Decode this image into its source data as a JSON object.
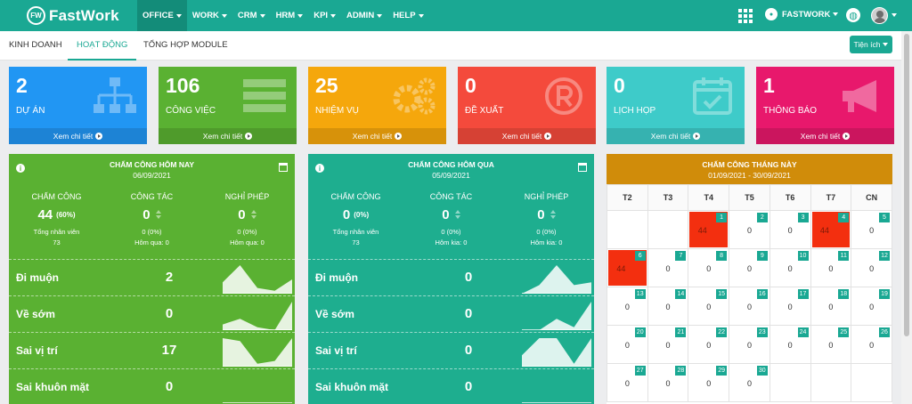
{
  "brand": {
    "logo_mark": "FW",
    "name": "FastWork"
  },
  "menu": [
    {
      "label": "OFFICE"
    },
    {
      "label": "WORK"
    },
    {
      "label": "CRM"
    },
    {
      "label": "HRM"
    },
    {
      "label": "KPI"
    },
    {
      "label": "ADMIN"
    },
    {
      "label": "HELP"
    }
  ],
  "header_right": {
    "company": "FASTWORK",
    "apps_icon": "grid-icon",
    "globe_icon": "globe-icon"
  },
  "subnav": {
    "tabs": [
      "KINH DOANH",
      "HOẠT ĐỘNG",
      "TỔNG HỢP MODULE"
    ],
    "active": "HOẠT ĐỘNG",
    "utility_button": "Tiện ích"
  },
  "stats": [
    {
      "value": "2",
      "label": "DỰ ÁN",
      "link": "Xem chi tiết",
      "color": "#2196f3",
      "icon": "sitemap-icon"
    },
    {
      "value": "106",
      "label": "CÔNG VIỆC",
      "link": "Xem chi tiết",
      "color": "#5ab132",
      "icon": "list-icon"
    },
    {
      "value": "25",
      "label": "NHIỆM VỤ",
      "link": "Xem chi tiết",
      "color": "#f5a70c",
      "icon": "gears-icon"
    },
    {
      "value": "0",
      "label": "ĐỀ XUẤT",
      "link": "Xem chi tiết",
      "color": "#f44a3c",
      "icon": "registered-icon"
    },
    {
      "value": "0",
      "label": "LỊCH HỌP",
      "link": "Xem chi tiết",
      "color": "#3ecbc9",
      "icon": "calendar-check-icon"
    },
    {
      "value": "1",
      "label": "THÔNG BÁO",
      "link": "Xem chi tiết",
      "color": "#e8186c",
      "icon": "megaphone-icon"
    }
  ],
  "today": {
    "title": "CHẤM CÔNG HÔM NAY",
    "date": "06/09/2021",
    "color": "#5ab132",
    "cols": [
      {
        "title": "CHẤM CÔNG",
        "value": "44",
        "extra": "(60%)",
        "sub1": "Tổng nhân viên",
        "sub2": "73"
      },
      {
        "title": "CÔNG TÁC",
        "value": "0",
        "extra": "",
        "sub1": "0 (0%)",
        "sub2": "Hôm qua: 0"
      },
      {
        "title": "NGHỈ PHÉP",
        "value": "0",
        "extra": "",
        "sub1": "0 (0%)",
        "sub2": "Hôm qua: 0"
      }
    ],
    "rows": [
      {
        "label": "Đi muộn",
        "value": "2",
        "spark": [
          4,
          10,
          2,
          1,
          5
        ]
      },
      {
        "label": "Về sớm",
        "value": "0",
        "spark": [
          2,
          4,
          1,
          0,
          10
        ]
      },
      {
        "label": "Sai vị trí",
        "value": "17",
        "spark": [
          10,
          9,
          1,
          2,
          10
        ]
      },
      {
        "label": "Sai khuôn mặt",
        "value": "0",
        "spark": [
          0,
          0,
          0,
          0,
          0
        ]
      }
    ]
  },
  "yesterday": {
    "title": "CHẤM CÔNG HÔM QUA",
    "date": "05/09/2021",
    "color": "#1eae8f",
    "cols": [
      {
        "title": "CHẤM CÔNG",
        "value": "0",
        "extra": "(0%)",
        "sub1": "Tổng nhân viên",
        "sub2": "73"
      },
      {
        "title": "CÔNG TÁC",
        "value": "0",
        "extra": "",
        "sub1": "0 (0%)",
        "sub2": "Hôm kia: 0"
      },
      {
        "title": "NGHỈ PHÉP",
        "value": "0",
        "extra": "",
        "sub1": "0 (0%)",
        "sub2": "Hôm kia: 0"
      }
    ],
    "rows": [
      {
        "label": "Đi muộn",
        "value": "0",
        "spark": [
          0,
          3,
          10,
          3,
          4
        ]
      },
      {
        "label": "Về sớm",
        "value": "0",
        "spark": [
          0,
          0,
          4,
          1,
          10
        ]
      },
      {
        "label": "Sai vị trí",
        "value": "0",
        "spark": [
          4,
          10,
          10,
          1,
          10
        ]
      },
      {
        "label": "Sai khuôn mặt",
        "value": "0",
        "spark": [
          0,
          0,
          0,
          0,
          0
        ]
      }
    ]
  },
  "month": {
    "title": "CHẤM CÔNG THÁNG NÀY",
    "range": "01/09/2021 - 30/09/2021",
    "weekdays": [
      "T2",
      "T3",
      "T4",
      "T5",
      "T6",
      "T7",
      "CN"
    ],
    "weeks": [
      [
        null,
        null,
        {
          "d": "1",
          "v": "44",
          "red": true
        },
        {
          "d": "2",
          "v": "0"
        },
        {
          "d": "3",
          "v": "0"
        },
        {
          "d": "4",
          "v": "44",
          "red": true
        },
        {
          "d": "5",
          "v": "0"
        }
      ],
      [
        {
          "d": "6",
          "v": "44",
          "red": true
        },
        {
          "d": "7",
          "v": "0"
        },
        {
          "d": "8",
          "v": "0"
        },
        {
          "d": "9",
          "v": "0"
        },
        {
          "d": "10",
          "v": "0"
        },
        {
          "d": "11",
          "v": "0"
        },
        {
          "d": "12",
          "v": "0"
        }
      ],
      [
        {
          "d": "13",
          "v": "0"
        },
        {
          "d": "14",
          "v": "0"
        },
        {
          "d": "15",
          "v": "0"
        },
        {
          "d": "16",
          "v": "0"
        },
        {
          "d": "17",
          "v": "0"
        },
        {
          "d": "18",
          "v": "0"
        },
        {
          "d": "19",
          "v": "0"
        }
      ],
      [
        {
          "d": "20",
          "v": "0"
        },
        {
          "d": "21",
          "v": "0"
        },
        {
          "d": "22",
          "v": "0"
        },
        {
          "d": "23",
          "v": "0"
        },
        {
          "d": "24",
          "v": "0"
        },
        {
          "d": "25",
          "v": "0"
        },
        {
          "d": "26",
          "v": "0"
        }
      ],
      [
        {
          "d": "27",
          "v": "0"
        },
        {
          "d": "28",
          "v": "0"
        },
        {
          "d": "29",
          "v": "0"
        },
        {
          "d": "30",
          "v": "0"
        },
        null,
        null,
        null
      ]
    ]
  }
}
